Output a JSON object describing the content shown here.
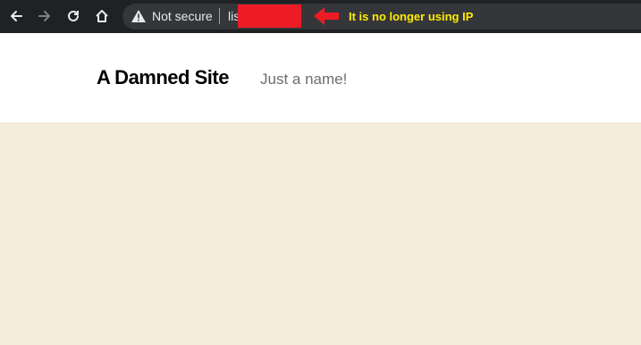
{
  "browser": {
    "security_label": "Not secure",
    "url_visible_fragment": "lis",
    "nav_icons": [
      "back-icon",
      "forward-icon",
      "reload-icon",
      "home-icon",
      "warning-icon"
    ]
  },
  "annotation": {
    "text": "It is no longer using IP",
    "text_color": "#ffec00",
    "arrow_color": "#ed1c24",
    "redaction_color": "#ed1c24"
  },
  "site": {
    "title": "A Damned Site",
    "tagline": "Just a name!",
    "content_background": "#f5ecdc"
  }
}
